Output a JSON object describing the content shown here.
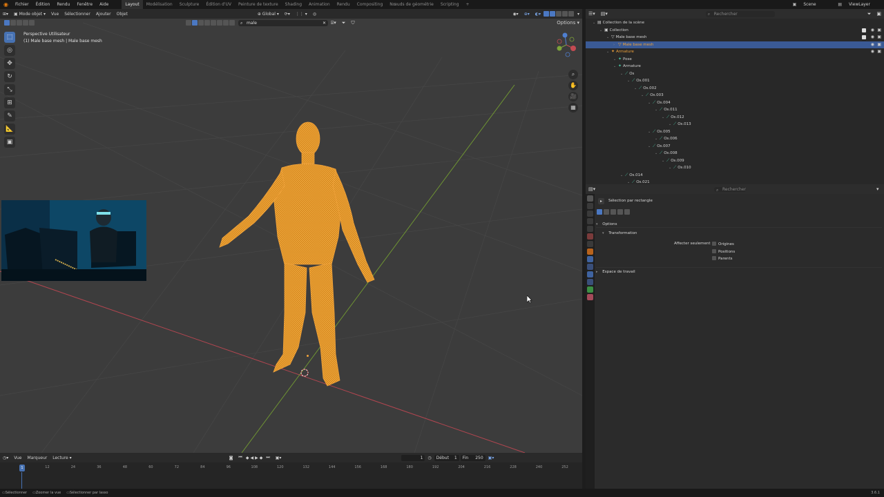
{
  "menubar": {
    "items": [
      "Fichier",
      "Édition",
      "Rendu",
      "Fenêtre",
      "Aide"
    ],
    "workspaces": [
      "Layout",
      "Modélisation",
      "Sculpture",
      "Édition d'UV",
      "Peinture de texture",
      "Shading",
      "Animation",
      "Rendu",
      "Compositing",
      "Nœuds de géométrie",
      "Scripting"
    ],
    "active_workspace": "Layout",
    "scene": "Scene",
    "view_layer": "ViewLayer"
  },
  "viewport": {
    "mode": "Mode objet",
    "menus": [
      "Vue",
      "Sélectionner",
      "Ajouter",
      "Objet"
    ],
    "orientation": "Global",
    "options_label": "Options",
    "search_value": "male",
    "overlay_title": "Perspective Utilisateur",
    "overlay_object": "(1) Male base mesh | Male base mesh"
  },
  "timeline": {
    "menus": [
      "Vue",
      "Marqueur",
      "Lecture"
    ],
    "current_frame": "1",
    "start_label": "Début",
    "start_value": "1",
    "end_label": "Fin",
    "end_value": "250",
    "ruler": [
      "1",
      "12",
      "24",
      "36",
      "48",
      "60",
      "72",
      "84",
      "96",
      "108",
      "120",
      "132",
      "144",
      "156",
      "168",
      "180",
      "192",
      "204",
      "216",
      "228",
      "240",
      "252"
    ]
  },
  "statusbar": {
    "items": [
      "Sélectionner",
      "Zoomer la vue",
      "Sélectionner par lasso"
    ]
  },
  "outliner": {
    "search_placeholder": "Rechercher",
    "rows": [
      {
        "label": "Collection de la scène",
        "indent": 0,
        "kind": "scene"
      },
      {
        "label": "Collection",
        "indent": 1,
        "kind": "collection"
      },
      {
        "label": "Male base mesh",
        "indent": 2,
        "kind": "object"
      },
      {
        "label": "Male base mesh",
        "indent": 3,
        "kind": "mesh",
        "selected": true
      },
      {
        "label": "Armature",
        "indent": 2,
        "kind": "armature"
      },
      {
        "label": "Pose",
        "indent": 3,
        "kind": "pose"
      },
      {
        "label": "Armature",
        "indent": 3,
        "kind": "armature-data"
      },
      {
        "label": "Os",
        "indent": 4,
        "kind": "bone"
      },
      {
        "label": "Os.001",
        "indent": 5,
        "kind": "bone"
      },
      {
        "label": "Os.002",
        "indent": 6,
        "kind": "bone"
      },
      {
        "label": "Os.003",
        "indent": 7,
        "kind": "bone"
      },
      {
        "label": "Os.004",
        "indent": 8,
        "kind": "bone"
      },
      {
        "label": "Os.011",
        "indent": 9,
        "kind": "bone"
      },
      {
        "label": "Os.012",
        "indent": 10,
        "kind": "bone"
      },
      {
        "label": "Os.013",
        "indent": 11,
        "kind": "bone"
      },
      {
        "label": "Os.005",
        "indent": 8,
        "kind": "bone"
      },
      {
        "label": "Os.006",
        "indent": 9,
        "kind": "bone"
      },
      {
        "label": "Os.007",
        "indent": 8,
        "kind": "bone"
      },
      {
        "label": "Os.008",
        "indent": 9,
        "kind": "bone"
      },
      {
        "label": "Os.009",
        "indent": 10,
        "kind": "bone"
      },
      {
        "label": "Os.010",
        "indent": 11,
        "kind": "bone"
      },
      {
        "label": "Os.014",
        "indent": 4,
        "kind": "bone"
      },
      {
        "label": "Os.021",
        "indent": 5,
        "kind": "bone"
      }
    ]
  },
  "properties": {
    "search_placeholder": "Rechercher",
    "tool_name": "Sélection par rectangle",
    "options_label": "Options",
    "transformation_label": "Transformation",
    "affect_only_label": "Affecter seulement",
    "affect_items": [
      "Origines",
      "Positions",
      "Parents"
    ],
    "workspace_label": "Espace de travail"
  },
  "colors": {
    "accent": "#4772b3",
    "mesh_wire": "#f0a23a",
    "bone_icon": "#49c6a3",
    "x_axis": "#c44b52",
    "y_axis": "#7ea33a"
  },
  "version": "3.6.1"
}
